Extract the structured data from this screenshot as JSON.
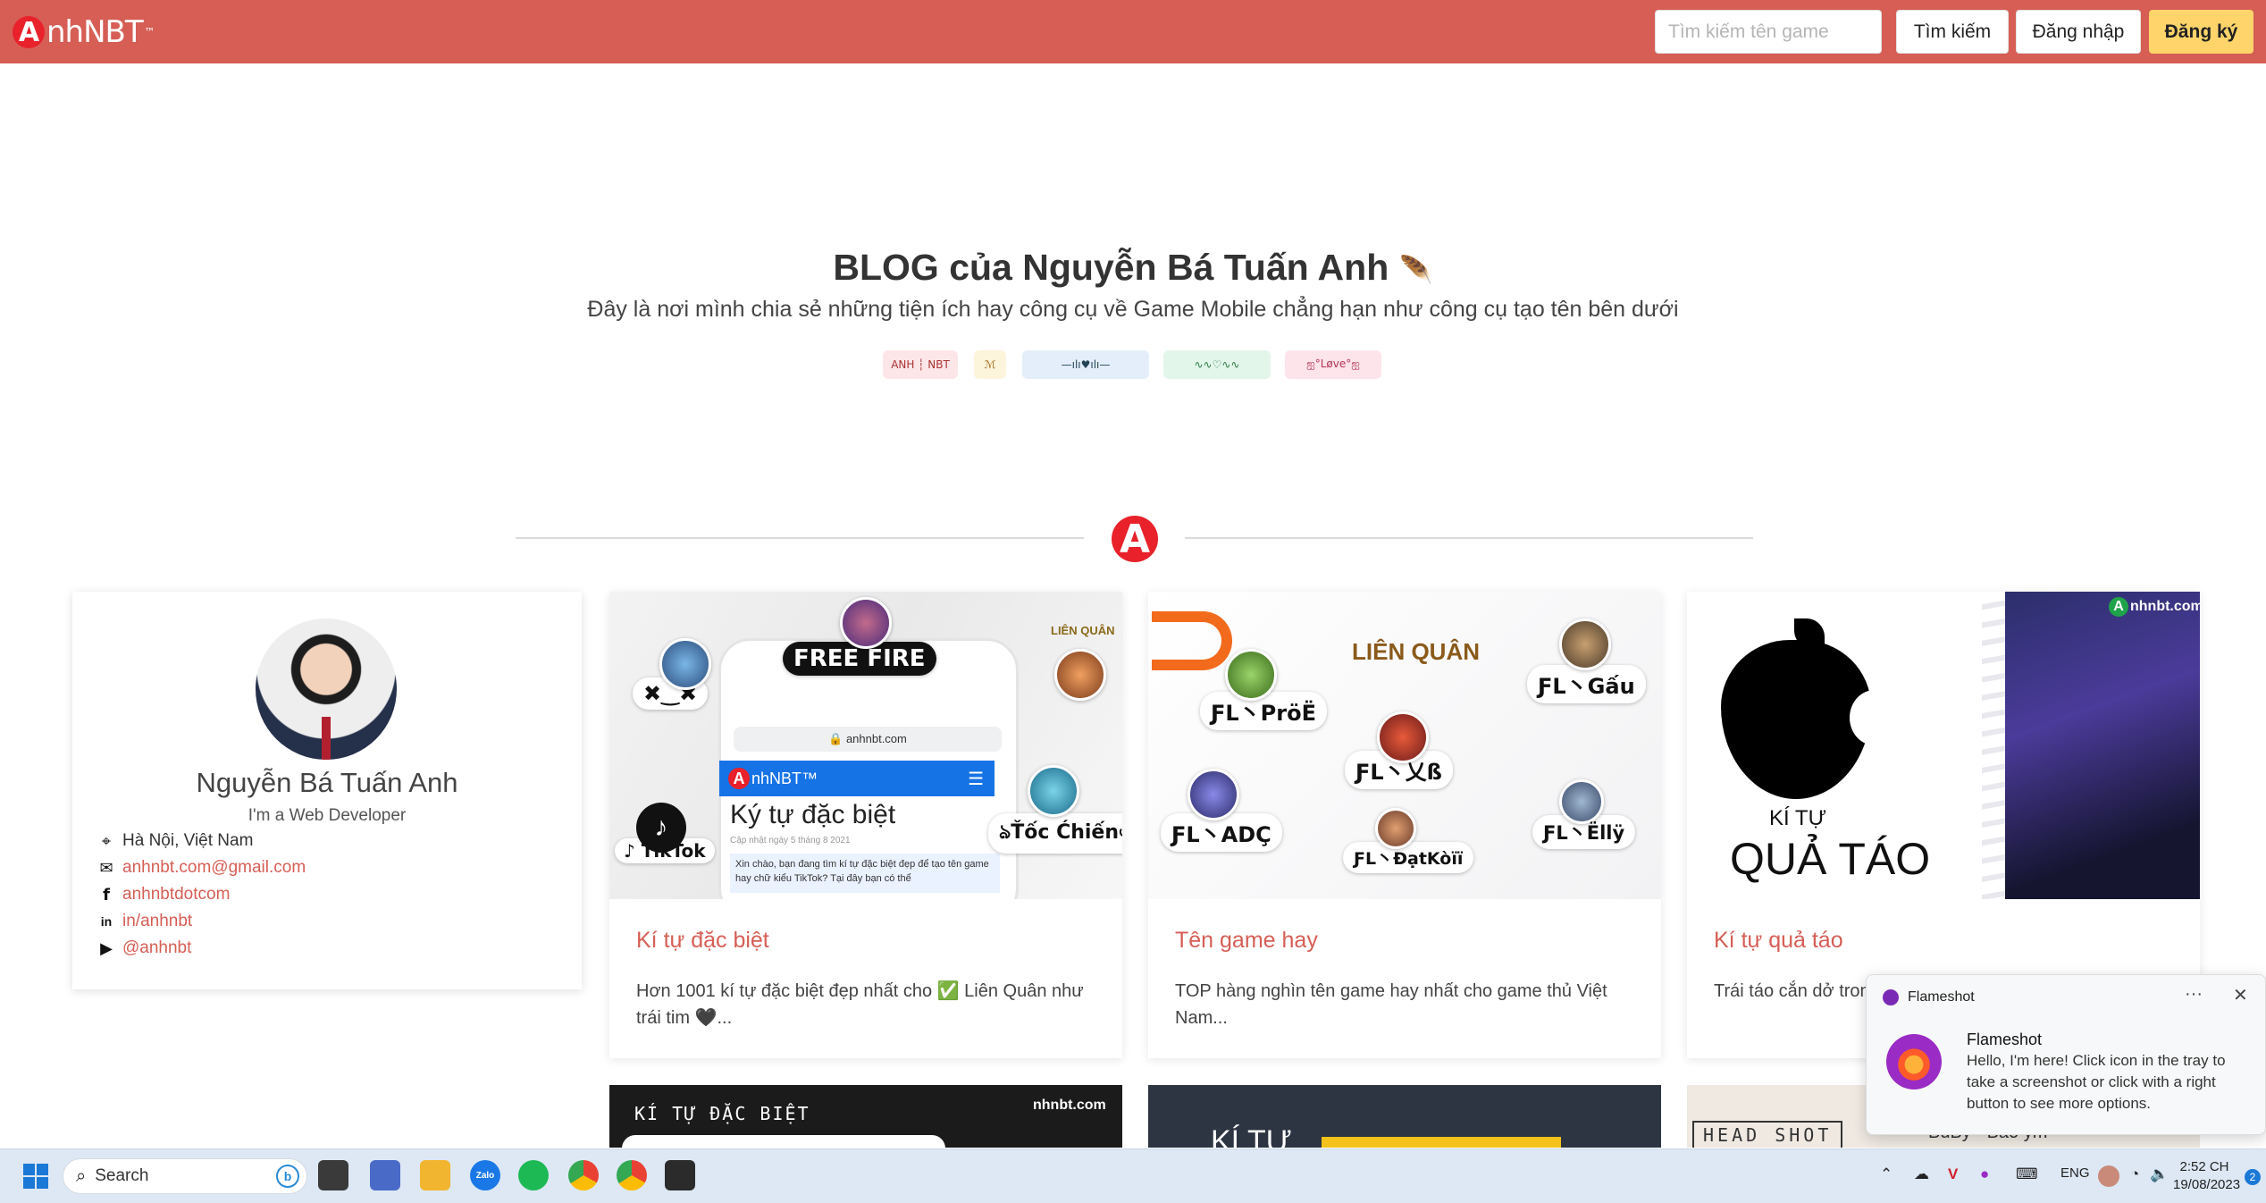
{
  "nav": {
    "logo_text": "nhNBT",
    "logo_letter": "A",
    "logo_tm": "™",
    "search_placeholder": "Tìm kiếm tên game",
    "search_button": "Tìm kiếm",
    "login_button": "Đăng nhập",
    "register_button": "Đăng ký"
  },
  "hero": {
    "title": "BLOG của Nguyễn Bá Tuấn Anh",
    "subtitle": "Đây là nơi mình chia sẻ những tiện ích hay công cụ về Game Mobile chẳng hạn như công cụ tạo tên bên dưới",
    "badges": [
      "ANH ┆ NBT",
      "ℳ",
      "—ılı♥ılı—",
      "∿∿♡∿∿",
      "ஐ°Løve°ஐ"
    ]
  },
  "divider_logo": "A",
  "profile": {
    "name": "Nguyễn Bá Tuấn Anh",
    "role": "I'm a Web Developer",
    "location": "Hà Nội, Việt Nam",
    "email": "anhnbt.com@gmail.com",
    "facebook": "anhnbtdotcom",
    "linkedin": "in/anhnbt",
    "youtube": "@anhnbt"
  },
  "cards": [
    {
      "title": "Kí tự đặc biệt",
      "desc": "Hơn 1001 kí tự đặc biệt đẹp nhất cho ✅ Liên Quân như trái tim 🖤...",
      "thumb": {
        "game1": "FREE FIRE",
        "game2": "LIÊN QUÂN",
        "url": "anhnbt.com",
        "site": "nhNBT™",
        "heading": "Ký tự đặc biệt",
        "date": "Cập nhật ngày 5 tháng 8 2021",
        "snippet": "Xin chào, bạn đang tìm kí tự đặc biệt đẹp để tạo tên game hay chữ kiểu TikTok? Tại đây bạn có thể",
        "tiktok": "TikTok",
        "sample": "ঌŤốc Ćhiếnঞ",
        "face": "✖‿✖"
      }
    },
    {
      "title": "Tên game hay",
      "desc": "TOP hàng nghìn tên game hay nhất cho game thủ Việt Nam...",
      "thumb": {
        "logo": "LIÊN QUÂN",
        "names": [
          "ƑL丶PröË",
          "ƑL丶Gấu",
          "ƑL丶乂ß",
          "ƑL丶ADÇ",
          "ƑL丶ĐạtKòïï",
          "ƑL丶Ëllÿ"
        ]
      }
    },
    {
      "title": "Kí tự quả táo",
      "desc": "Trái táo cắn dở tron... đỏ 🍎...",
      "thumb": {
        "small": "KÍ TỰ",
        "big": "QUẢ TÁO",
        "brand": "nhnbt.com"
      }
    }
  ],
  "bottom_cards": [
    {
      "text": "KÍ TỰ ĐẶC BIỆT",
      "brand": "nhnbt.com"
    },
    {
      "text": "KÍ TỰ"
    },
    {
      "text": "HEAD SHOT",
      "extra": "BuBy ˙ Bảo ym"
    }
  ],
  "toast": {
    "app": "Flameshot",
    "more": "···",
    "close": "✕",
    "title": "Flameshot",
    "body": "Hello, I'm here! Click icon in the tray to take a screenshot or click with a right button to see more options."
  },
  "taskbar": {
    "search_label": "Search",
    "lang": "ENG",
    "time": "2:52 CH",
    "date": "19/08/2023",
    "notif_count": "2",
    "apps": [
      "file-explorer",
      "zalo",
      "spotify",
      "chrome",
      "chrome-profile",
      "terminal"
    ],
    "zalo_label": "Zalo"
  },
  "colors": {
    "brand": "#d65e55",
    "register": "#ffd56b",
    "accent_red": "#e8212b"
  }
}
